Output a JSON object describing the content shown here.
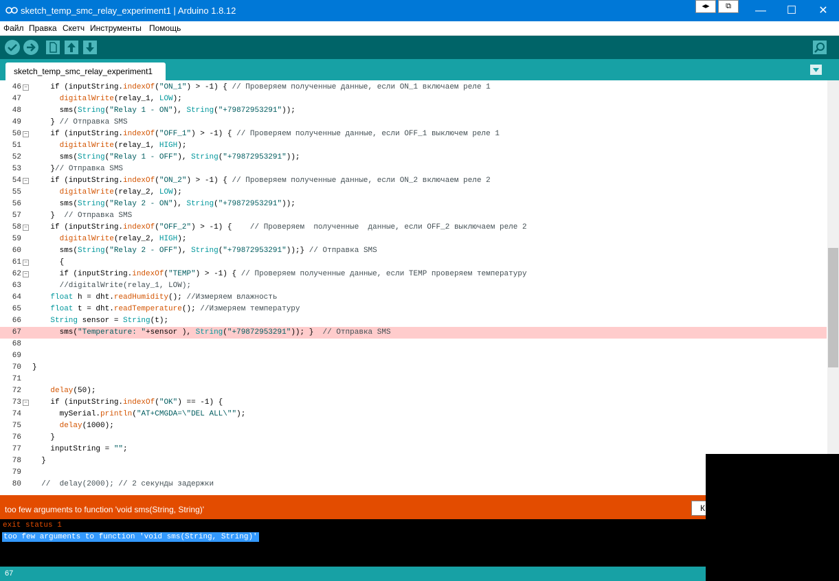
{
  "window": {
    "title": "sketch_temp_smc_relay_experiment1 | Arduino 1.8.12",
    "extra_buttons": [
      "◂▸",
      "⧉"
    ],
    "controls": {
      "minimize": "—",
      "maximize": "☐",
      "close": "✕"
    }
  },
  "menu": [
    "Файл",
    "Правка",
    "Скетч",
    "Инструменты",
    "Помощь"
  ],
  "toolbar": {
    "buttons": [
      "verify-icon",
      "upload-icon",
      "new-icon",
      "open-icon",
      "save-icon"
    ],
    "serial_monitor": "serial-monitor-icon"
  },
  "tab": {
    "label": "sketch_temp_smc_relay_experiment1"
  },
  "editor": {
    "highlighted_line": "67",
    "lines": [
      {
        "n": "46",
        "fold": true,
        "html": "    <span class='kw-'>if</span> (inputString.<span class='kw-func'>indexOf</span>(<span class='str'>\"ON_1\"</span>) > -1) { <span class='cmt'>// Проверяем полученные данные, если ON_1 включаем реле 1</span>"
      },
      {
        "n": "47",
        "fold": false,
        "html": "      <span class='kw-func'>digitalWrite</span>(relay_1, <span class='kw-const'>LOW</span>);"
      },
      {
        "n": "48",
        "fold": false,
        "html": "      sms(<span class='kw-type'>String</span>(<span class='str'>\"Relay 1 - ON\"</span>), <span class='kw-type'>String</span>(<span class='str'>\"+79872953291\"</span>));"
      },
      {
        "n": "49",
        "fold": false,
        "html": "    } <span class='cmt'>// Отправка SMS</span>"
      },
      {
        "n": "50",
        "fold": true,
        "html": "    if (inputString.<span class='kw-func'>indexOf</span>(<span class='str'>\"OFF_1\"</span>) > -1) { <span class='cmt'>// Проверяем полученные данные, если OFF_1 выключем реле 1</span>"
      },
      {
        "n": "51",
        "fold": false,
        "html": "      <span class='kw-func'>digitalWrite</span>(relay_1, <span class='kw-const'>HIGH</span>);"
      },
      {
        "n": "52",
        "fold": false,
        "html": "      sms(<span class='kw-type'>String</span>(<span class='str'>\"Relay 1 - OFF\"</span>), <span class='kw-type'>String</span>(<span class='str'>\"+79872953291\"</span>));"
      },
      {
        "n": "53",
        "fold": false,
        "html": "    }<span class='cmt'>// Отправка SMS</span>"
      },
      {
        "n": "54",
        "fold": true,
        "html": "    if (inputString.<span class='kw-func'>indexOf</span>(<span class='str'>\"ON_2\"</span>) > -1) { <span class='cmt'>// Проверяем полученные данные, если ON_2 включаем реле 2</span>"
      },
      {
        "n": "55",
        "fold": false,
        "html": "      <span class='kw-func'>digitalWrite</span>(relay_2, <span class='kw-const'>LOW</span>);"
      },
      {
        "n": "56",
        "fold": false,
        "html": "      sms(<span class='kw-type'>String</span>(<span class='str'>\"Relay 2 - ON\"</span>), <span class='kw-type'>String</span>(<span class='str'>\"+79872953291\"</span>));"
      },
      {
        "n": "57",
        "fold": false,
        "html": "    }  <span class='cmt'>// Отправка SMS</span>"
      },
      {
        "n": "58",
        "fold": true,
        "html": "    if (inputString.<span class='kw-func'>indexOf</span>(<span class='str'>\"OFF_2\"</span>) > -1) {    <span class='cmt'>// Проверяем  полученные  данные, если OFF_2 выключаем реле 2</span>"
      },
      {
        "n": "59",
        "fold": false,
        "html": "      <span class='kw-func'>digitalWrite</span>(relay_2, <span class='kw-const'>HIGH</span>);"
      },
      {
        "n": "60",
        "fold": false,
        "html": "      sms(<span class='kw-type'>String</span>(<span class='str'>\"Relay 2 - OFF\"</span>), <span class='kw-type'>String</span>(<span class='str'>\"+79872953291\"</span>));} <span class='cmt'>// Отправка SMS</span>"
      },
      {
        "n": "61",
        "fold": true,
        "html": "      {"
      },
      {
        "n": "62",
        "fold": true,
        "html": "      if (inputString.<span class='kw-func'>indexOf</span>(<span class='str'>\"TEMP\"</span>) > -1) { <span class='cmt'>// Проверяем полученные данные, если TEMP проверяем температуру</span>"
      },
      {
        "n": "63",
        "fold": false,
        "html": "      <span class='cmt'>//digitalWrite(relay_1, LOW);</span>"
      },
      {
        "n": "64",
        "fold": false,
        "html": "    <span class='kw-type'>float</span> h = dht.<span class='kw-func'>readHumidity</span>(); <span class='cmt'>//Измеряем влажность</span>"
      },
      {
        "n": "65",
        "fold": false,
        "html": "    <span class='kw-type'>float</span> t = dht.<span class='kw-func'>readTemperature</span>(); <span class='cmt'>//Измеряем температуру</span>"
      },
      {
        "n": "66",
        "fold": false,
        "html": "    <span class='kw-type'>String</span> sensor = <span class='kw-type'>String</span>(t);"
      },
      {
        "n": "67",
        "fold": false,
        "html": "      sms(<span class='str'>\"Temperature: \"</span>+sensor ), <span class='kw-type'>String</span>(<span class='str'>\"+79872953291\"</span>)); }  <span class='cmt'>// Отправка SMS</span>"
      },
      {
        "n": "68",
        "fold": false,
        "html": ""
      },
      {
        "n": "69",
        "fold": false,
        "html": ""
      },
      {
        "n": "70",
        "fold": false,
        "html": "}"
      },
      {
        "n": "71",
        "fold": false,
        "html": ""
      },
      {
        "n": "72",
        "fold": false,
        "html": "    <span class='kw-func'>delay</span>(50);"
      },
      {
        "n": "73",
        "fold": true,
        "html": "    if (inputString.<span class='kw-func'>indexOf</span>(<span class='str'>\"OK\"</span>) == -1) {"
      },
      {
        "n": "74",
        "fold": false,
        "html": "      mySerial.<span class='kw-func'>println</span>(<span class='str'>\"AT+CMGDA=\\\"DEL ALL\\\"\"</span>);"
      },
      {
        "n": "75",
        "fold": false,
        "html": "      <span class='kw-func'>delay</span>(1000);"
      },
      {
        "n": "76",
        "fold": false,
        "html": "    }"
      },
      {
        "n": "77",
        "fold": false,
        "html": "    inputString = <span class='str'>\"\"</span>;"
      },
      {
        "n": "78",
        "fold": false,
        "html": "  }"
      },
      {
        "n": "79",
        "fold": false,
        "html": ""
      },
      {
        "n": "80",
        "fold": false,
        "html": "  <span class='cmt'>//  delay(2000); // 2 секунды задержки</span>"
      }
    ]
  },
  "error_bar": {
    "message": "too few arguments to function 'void sms(String, String)'",
    "copy_button": "К"
  },
  "console": {
    "line1": "exit status 1",
    "line2": "too few arguments to function 'void sms(String, String)'"
  },
  "status": {
    "line_number": "67"
  },
  "colors": {
    "titlebar": "#0078d7",
    "toolbar": "#006468",
    "tabbar": "#17a1a5",
    "error": "#e34c00"
  }
}
